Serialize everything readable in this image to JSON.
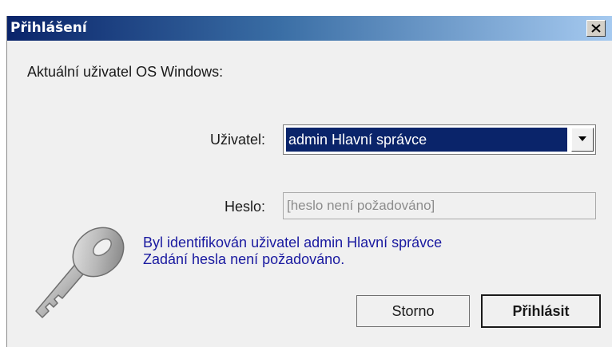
{
  "window": {
    "title": "Přihlášení"
  },
  "current_user_label": "Aktuální uživatel OS Windows:",
  "user_field": {
    "label": "Uživatel:",
    "selected_value": "admin Hlavní správce"
  },
  "password_field": {
    "label": "Heslo:",
    "placeholder": "[heslo není požadováno]",
    "value": ""
  },
  "message": {
    "line1": "Byl identifikován uživatel admin Hlavní správce",
    "line2": "Zadání hesla není požadováno."
  },
  "buttons": {
    "cancel_label": "Storno",
    "login_label": "Přihlásit"
  },
  "icons": {
    "close": "close-icon",
    "dropdown": "chevron-down-icon",
    "key": "key-icon"
  },
  "colors": {
    "titlebar_start": "#0a246a",
    "titlebar_end": "#a6caf0",
    "selection": "#0a246a",
    "message_text": "#1a1aa0"
  }
}
